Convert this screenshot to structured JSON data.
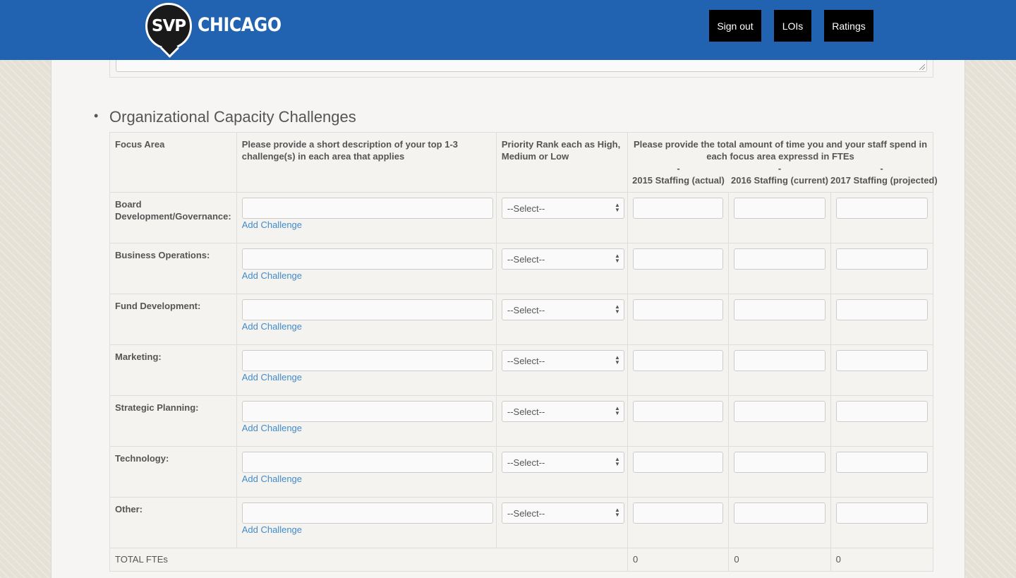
{
  "header": {
    "logo_badge": "SVP",
    "logo_word": "CHICAGO",
    "nav": [
      {
        "label": "Sign out"
      },
      {
        "label": "LOIs"
      },
      {
        "label": "Ratings"
      }
    ]
  },
  "section": {
    "title": "Organizational Capacity Challenges"
  },
  "table": {
    "headers": {
      "focus_area": "Focus Area",
      "description": "Please provide a short description of your top 1-3 challenge(s) in each area that applies",
      "priority": "Priority Rank each as High, Medium or Low",
      "time": "Please provide the total amount of time you and your staff spend in each focus area expressd in FTEs",
      "col_2015_dash": "-",
      "col_2015": "2015 Staffing (actual)",
      "col_2016_dash": "-",
      "col_2016": "2016 Staffing (current)",
      "col_2017_dash": "-",
      "col_2017": "2017 Staffing (projected)"
    },
    "rows": [
      {
        "label": "Board Development/Governance:",
        "add_link": "Add Challenge",
        "select": "--Select--",
        "desc_value": "",
        "fte_2015": "",
        "fte_2016": "",
        "fte_2017": ""
      },
      {
        "label": "Business Operations:",
        "add_link": "Add Challenge",
        "select": "--Select--",
        "desc_value": "",
        "fte_2015": "",
        "fte_2016": "",
        "fte_2017": ""
      },
      {
        "label": "Fund Development:",
        "add_link": "Add Challenge",
        "select": "--Select--",
        "desc_value": "",
        "fte_2015": "",
        "fte_2016": "",
        "fte_2017": ""
      },
      {
        "label": "Marketing:",
        "add_link": "Add Challenge",
        "select": "--Select--",
        "desc_value": "",
        "fte_2015": "",
        "fte_2016": "",
        "fte_2017": ""
      },
      {
        "label": "Strategic Planning:",
        "add_link": "Add Challenge",
        "select": "--Select--",
        "desc_value": "",
        "fte_2015": "",
        "fte_2016": "",
        "fte_2017": ""
      },
      {
        "label": "Technology:",
        "add_link": "Add Challenge",
        "select": "--Select--",
        "desc_value": "",
        "fte_2015": "",
        "fte_2016": "",
        "fte_2017": ""
      },
      {
        "label": "Other:",
        "add_link": "Add Challenge",
        "select": "--Select--",
        "desc_value": "",
        "fte_2015": "",
        "fte_2016": "",
        "fte_2017": ""
      }
    ],
    "total": {
      "label": "TOTAL FTEs",
      "v2015": "0",
      "v2016": "0",
      "v2017": "0"
    }
  },
  "colors": {
    "header_bg": "#2163b0",
    "nav_bg": "#000000",
    "link": "#428bca",
    "page_bg": "#e6e1d6",
    "content_bg": "#f6f5f3"
  },
  "icons": {
    "select_arrow": "updown-arrows-icon"
  }
}
